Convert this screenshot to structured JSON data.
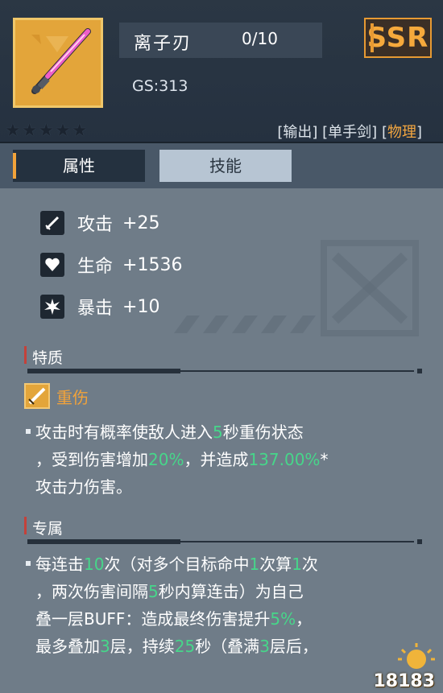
{
  "weapon": {
    "name": "离子刃",
    "level": "0/10",
    "gs": "GS:313",
    "rarity": "SSR",
    "stars_text": "★★★★★",
    "tags": {
      "output": "[输出]",
      "one_hand": "[单手剑]",
      "phys_open": "[",
      "phys": "物理",
      "phys_close": "]"
    },
    "icon": "pink-sword-icon",
    "colors": {
      "rarity": "#e79a33",
      "frame": "#e3a53a",
      "highlight": "#47d68a",
      "accent": "#f2a33a"
    }
  },
  "tabs": [
    {
      "label": "属性"
    },
    {
      "label": "技能"
    }
  ],
  "stats": [
    {
      "icon": "sword-icon",
      "label": "攻击",
      "value": "+25"
    },
    {
      "icon": "heart-icon",
      "label": "生命",
      "value": "+1536"
    },
    {
      "icon": "burst-icon",
      "label": "暴击",
      "value": "+10"
    }
  ],
  "trait": {
    "section_title": "特质",
    "skill_name": "重伤",
    "skill_icon": "blade-icon",
    "line1_a": "攻击时有概率使敌人进入",
    "line1_b": "5",
    "line1_c": "秒重伤状态",
    "line2_a": "，受到伤害增加",
    "line2_b": "20%",
    "line2_c": "，并造成",
    "line2_d": "137.00%",
    "line2_e": "*",
    "line3": "攻击力伤害。"
  },
  "exclusive": {
    "section_title": "专属",
    "l1_a": "每连击",
    "l1_b": "10",
    "l1_c": "次（对多个目标命中",
    "l1_d": "1",
    "l1_e": "次算",
    "l1_f": "1",
    "l1_g": "次",
    "l2_a": "，两次伤害间隔",
    "l2_b": "5",
    "l2_c": "秒内算连击）为自己",
    "l3_a": "叠一层BUFF：造成最终伤害提升",
    "l3_b": "5%",
    "l3_c": "，",
    "l4_a": "最多叠加",
    "l4_b": "3",
    "l4_c": "层，持续",
    "l4_d": "25",
    "l4_e": "秒（叠满",
    "l4_f": "3",
    "l4_g": "层后，"
  },
  "watermark": {
    "text": "18183"
  }
}
